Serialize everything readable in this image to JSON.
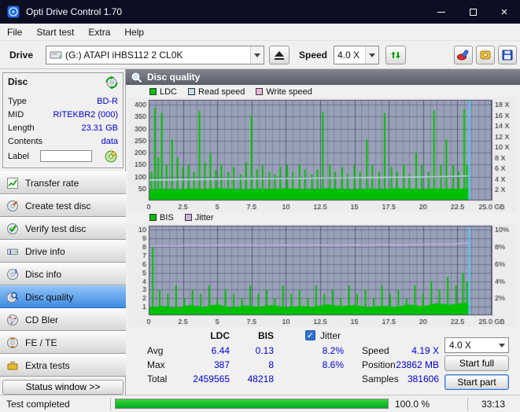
{
  "window": {
    "title": "Opti Drive Control 1.70"
  },
  "menu": {
    "items": [
      {
        "label": "File"
      },
      {
        "label": "Start test"
      },
      {
        "label": "Extra"
      },
      {
        "label": "Help"
      }
    ]
  },
  "toolbar": {
    "drive_label": "Drive",
    "drive_value": "(G:)  ATAPI iHBS112  2 CL0K",
    "speed_label": "Speed",
    "speed_value": "4.0 X"
  },
  "disc_panel": {
    "title": "Disc",
    "fields": [
      {
        "label": "Type",
        "value": "BD-R"
      },
      {
        "label": "MID",
        "value": "RITEKBR2 (000)"
      },
      {
        "label": "Length",
        "value": "23.31 GB"
      },
      {
        "label": "Contents",
        "value": "data"
      },
      {
        "label": "Label",
        "value": ""
      }
    ]
  },
  "nav": {
    "items": [
      {
        "label": "Transfer rate"
      },
      {
        "label": "Create test disc"
      },
      {
        "label": "Verify test disc"
      },
      {
        "label": "Drive info"
      },
      {
        "label": "Disc info"
      },
      {
        "label": "Disc quality",
        "selected": true
      },
      {
        "label": "CD Bler"
      },
      {
        "label": "FE / TE"
      },
      {
        "label": "Extra tests"
      }
    ]
  },
  "status_window": {
    "label": "Status window >>"
  },
  "main": {
    "title": "Disc quality"
  },
  "stats": {
    "col_ldc": "LDC",
    "col_bis": "BIS",
    "rows": [
      {
        "label": "Avg",
        "ldc": "6.44",
        "bis": "0.13"
      },
      {
        "label": "Max",
        "ldc": "387",
        "bis": "8"
      },
      {
        "label": "Total",
        "ldc": "2459565",
        "bis": "48218"
      }
    ],
    "jitter": {
      "label": "Jitter",
      "checked": true,
      "avg": "8.2%",
      "max": "8.6%"
    },
    "speed": {
      "label": "Speed",
      "value": "4.19 X",
      "selector": "4.0 X"
    },
    "position": {
      "label": "Position",
      "value": "23862 MB"
    },
    "samples": {
      "label": "Samples",
      "value": "381606"
    },
    "buttons": {
      "start_full": "Start full",
      "start_part": "Start part"
    }
  },
  "statusbar": {
    "text": "Test completed",
    "percent": 100,
    "percent_label": "100.0 %",
    "time": "33:13"
  },
  "chart_data": [
    {
      "type": "bar",
      "x_unit": "GB",
      "xlim": [
        0,
        25
      ],
      "x_minor_step": 0.5,
      "x_ticks": [
        [
          0,
          "0"
        ],
        [
          2.5,
          "2.5"
        ],
        [
          5,
          "5"
        ],
        [
          7.5,
          "7.5"
        ],
        [
          10,
          "10"
        ],
        [
          12.5,
          "12.5"
        ],
        [
          15,
          "15"
        ],
        [
          17.5,
          "17.5"
        ],
        [
          20,
          "20"
        ],
        [
          22.5,
          "22.5"
        ],
        [
          25,
          "25.0 GB"
        ]
      ],
      "ylim": [
        0,
        420
      ],
      "y_ticks_left": [
        [
          50,
          "50"
        ],
        [
          100,
          "100"
        ],
        [
          150,
          "150"
        ],
        [
          200,
          "200"
        ],
        [
          250,
          "250"
        ],
        [
          300,
          "300"
        ],
        [
          350,
          "350"
        ],
        [
          400,
          "400"
        ]
      ],
      "right_max": 18.9,
      "y_ticks_right": [
        [
          2,
          "2 X"
        ],
        [
          4,
          "4 X"
        ],
        [
          6,
          "6 X"
        ],
        [
          8,
          "8 X"
        ],
        [
          10,
          "10 X"
        ],
        [
          12,
          "12 X"
        ],
        [
          14,
          "14 X"
        ],
        [
          16,
          "16 X"
        ],
        [
          18,
          "18 X"
        ]
      ],
      "data_end": 23.31,
      "plot_bg": "#9aa0b8",
      "grid": true,
      "legend_position": "top-left",
      "series": [
        {
          "name": "LDC",
          "type": "bars",
          "color": "#00c000",
          "baseline": [
            [
              0,
              44
            ],
            [
              1,
              48
            ],
            [
              2,
              46
            ],
            [
              3,
              50
            ],
            [
              4,
              47
            ],
            [
              5,
              52
            ],
            [
              6,
              48
            ],
            [
              7,
              45
            ],
            [
              8,
              50
            ],
            [
              9,
              47
            ],
            [
              10,
              52
            ],
            [
              11,
              48
            ],
            [
              12,
              46
            ],
            [
              13,
              51
            ],
            [
              14,
              48
            ],
            [
              15,
              46
            ],
            [
              16,
              50
            ],
            [
              17,
              47
            ],
            [
              18,
              51
            ],
            [
              19,
              48
            ],
            [
              20,
              47
            ],
            [
              21,
              50
            ],
            [
              22,
              48
            ],
            [
              23,
              50
            ],
            [
              23.31,
              49
            ]
          ],
          "points": [
            [
              0.2,
              120
            ],
            [
              0.45,
              387
            ],
            [
              0.7,
              180
            ],
            [
              0.95,
              365
            ],
            [
              1.3,
              150
            ],
            [
              1.7,
              255
            ],
            [
              2.1,
              180
            ],
            [
              2.5,
              140
            ],
            [
              2.9,
              150
            ],
            [
              3.3,
              120
            ],
            [
              3.7,
              375
            ],
            [
              4.1,
              160
            ],
            [
              4.5,
              200
            ],
            [
              4.9,
              130
            ],
            [
              5.3,
              150
            ],
            [
              5.8,
              120
            ],
            [
              6.2,
              140
            ],
            [
              6.7,
              110
            ],
            [
              7.1,
              160
            ],
            [
              7.5,
              355
            ],
            [
              7.9,
              130
            ],
            [
              8.3,
              150
            ],
            [
              8.8,
              120
            ],
            [
              9.2,
              110
            ],
            [
              9.6,
              140
            ],
            [
              10.1,
              150
            ],
            [
              10.5,
              120
            ],
            [
              11,
              150
            ],
            [
              11.4,
              130
            ],
            [
              11.9,
              110
            ],
            [
              12.3,
              130
            ],
            [
              12.7,
              370
            ],
            [
              13.2,
              150
            ],
            [
              13.6,
              120
            ],
            [
              14.1,
              140
            ],
            [
              14.5,
              110
            ],
            [
              15,
              150
            ],
            [
              15.4,
              120
            ],
            [
              15.9,
              255
            ],
            [
              16.3,
              150
            ],
            [
              16.8,
              120
            ],
            [
              17.2,
              365
            ],
            [
              17.7,
              140
            ],
            [
              18.1,
              120
            ],
            [
              18.6,
              150
            ],
            [
              19,
              110
            ],
            [
              19.5,
              200
            ],
            [
              19.9,
              150
            ],
            [
              20.4,
              120
            ],
            [
              20.8,
              375
            ],
            [
              21.3,
              150
            ],
            [
              21.7,
              255
            ],
            [
              22.2,
              150
            ],
            [
              22.6,
              120
            ],
            [
              23,
              380
            ],
            [
              23.2,
              150
            ]
          ]
        },
        {
          "name": "Read speed",
          "type": "line",
          "axis": "right",
          "color": "#c3dcea",
          "points": [
            [
              0,
              3.85
            ],
            [
              2,
              3.92
            ],
            [
              4,
              3.98
            ],
            [
              6,
              4.05
            ],
            [
              8,
              4.1
            ],
            [
              10,
              4.15
            ],
            [
              12,
              4.2
            ],
            [
              14,
              4.26
            ],
            [
              16,
              4.32
            ],
            [
              18,
              4.38
            ],
            [
              20,
              4.44
            ],
            [
              21.5,
              4.48
            ],
            [
              22.5,
              4.55
            ],
            [
              23.31,
              4.6
            ]
          ]
        },
        {
          "name": "Write speed",
          "type": "line",
          "axis": "right",
          "color": "#eab9dc",
          "points": []
        }
      ]
    },
    {
      "type": "bar",
      "x_unit": "GB",
      "xlim": [
        0,
        25
      ],
      "x_minor_step": 0.5,
      "x_ticks": [
        [
          0,
          "0"
        ],
        [
          2.5,
          "2.5"
        ],
        [
          5,
          "5"
        ],
        [
          7.5,
          "7.5"
        ],
        [
          10,
          "10"
        ],
        [
          12.5,
          "12.5"
        ],
        [
          15,
          "15"
        ],
        [
          17.5,
          "17.5"
        ],
        [
          20,
          "20"
        ],
        [
          22.5,
          "22.5"
        ],
        [
          25,
          "25.0 GB"
        ]
      ],
      "ylim": [
        0,
        10.5
      ],
      "y_ticks_left": [
        [
          1,
          "1"
        ],
        [
          2,
          "2"
        ],
        [
          3,
          "3"
        ],
        [
          4,
          "4"
        ],
        [
          5,
          "5"
        ],
        [
          6,
          "6"
        ],
        [
          7,
          "7"
        ],
        [
          8,
          "8"
        ],
        [
          9,
          "9"
        ],
        [
          10,
          "10"
        ]
      ],
      "right_max": 10.5,
      "y_ticks_right": [
        [
          2,
          "2%"
        ],
        [
          4,
          "4%"
        ],
        [
          6,
          "6%"
        ],
        [
          8,
          "8%"
        ],
        [
          10,
          "10%"
        ]
      ],
      "data_end": 23.31,
      "plot_bg": "#9aa0b8",
      "grid": true,
      "legend_position": "top-left",
      "series": [
        {
          "name": "BIS",
          "type": "bars",
          "color": "#00c000",
          "baseline": [
            [
              0,
              0.9
            ],
            [
              1,
              1.1
            ],
            [
              2,
              0.85
            ],
            [
              3,
              1.2
            ],
            [
              4,
              1.0
            ],
            [
              5,
              1.3
            ],
            [
              6,
              0.9
            ],
            [
              7,
              1.15
            ],
            [
              8,
              1.0
            ],
            [
              9,
              1.2
            ],
            [
              10,
              0.95
            ],
            [
              11,
              1.1
            ],
            [
              12,
              1.0
            ],
            [
              13,
              1.3
            ],
            [
              14,
              1.05
            ],
            [
              15,
              1.2
            ],
            [
              16,
              0.95
            ],
            [
              17,
              1.1
            ],
            [
              18,
              1.0
            ],
            [
              19,
              1.25
            ],
            [
              20,
              1.05
            ],
            [
              21,
              1.4
            ],
            [
              22,
              1.25
            ],
            [
              23,
              1.5
            ],
            [
              23.31,
              1.3
            ]
          ],
          "points": [
            [
              0.3,
              8
            ],
            [
              0.8,
              3
            ],
            [
              1.4,
              2.5
            ],
            [
              2,
              3.5
            ],
            [
              2.6,
              2
            ],
            [
              3.2,
              3
            ],
            [
              3.8,
              2.5
            ],
            [
              4.4,
              3.5
            ],
            [
              5,
              2
            ],
            [
              5.6,
              3
            ],
            [
              6.2,
              2.5
            ],
            [
              6.8,
              2
            ],
            [
              7.4,
              3.5
            ],
            [
              8,
              2.5
            ],
            [
              8.6,
              3
            ],
            [
              9.2,
              2
            ],
            [
              9.8,
              3.5
            ],
            [
              10.4,
              2.5
            ],
            [
              11,
              3
            ],
            [
              11.6,
              2
            ],
            [
              12.2,
              3.5
            ],
            [
              12.8,
              2.5
            ],
            [
              13.4,
              3
            ],
            [
              14,
              2
            ],
            [
              14.6,
              3.5
            ],
            [
              15.2,
              2.5
            ],
            [
              15.8,
              3
            ],
            [
              16.4,
              2
            ],
            [
              17,
              3.5
            ],
            [
              17.6,
              2.5
            ],
            [
              18.2,
              3
            ],
            [
              18.8,
              2
            ],
            [
              19.4,
              3.5
            ],
            [
              20,
              2.5
            ],
            [
              20.6,
              4
            ],
            [
              21.2,
              3
            ],
            [
              21.8,
              4.5
            ],
            [
              22.4,
              3.5
            ],
            [
              22.9,
              5
            ],
            [
              23.2,
              4
            ]
          ]
        },
        {
          "name": "Jitter",
          "type": "line",
          "axis": "right",
          "color": "#c9b0e2",
          "points": [
            [
              0,
              8.1
            ],
            [
              1,
              8.15
            ],
            [
              2,
              8.1
            ],
            [
              3,
              8.2
            ],
            [
              4,
              8.15
            ],
            [
              5,
              8.2
            ],
            [
              6,
              8.18
            ],
            [
              7,
              8.22
            ],
            [
              8,
              8.15
            ],
            [
              9,
              8.2
            ],
            [
              10,
              8.22
            ],
            [
              11,
              8.18
            ],
            [
              12,
              8.25
            ],
            [
              13,
              8.2
            ],
            [
              14,
              8.22
            ],
            [
              15,
              8.25
            ],
            [
              16,
              8.2
            ],
            [
              17,
              8.28
            ],
            [
              18,
              8.22
            ],
            [
              19,
              8.25
            ],
            [
              20,
              8.3
            ],
            [
              21,
              8.35
            ],
            [
              22,
              8.3
            ],
            [
              23,
              8.45
            ],
            [
              23.31,
              8.5
            ]
          ]
        }
      ]
    }
  ]
}
